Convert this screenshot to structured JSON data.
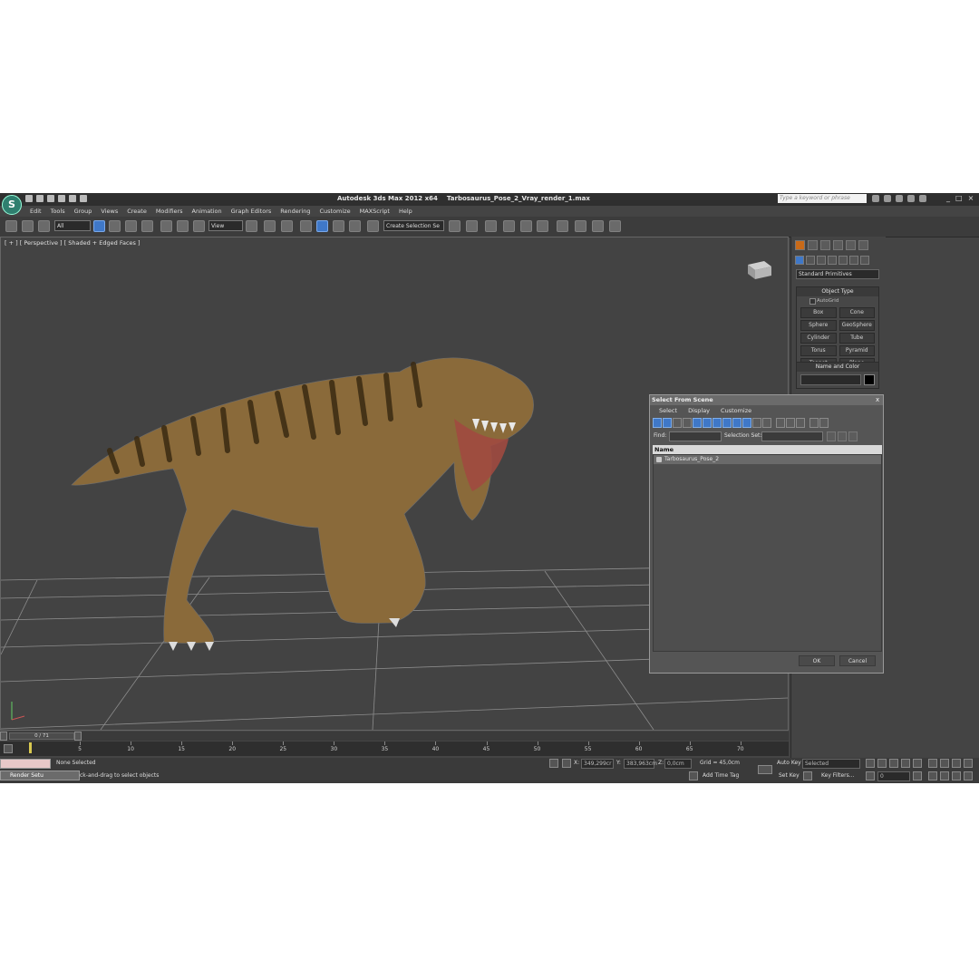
{
  "app": {
    "title": "Autodesk 3ds Max  2012 x64",
    "file": "Tarbosaurus_Pose_2_Vray_render_1.max",
    "search_placeholder": "Type a keyword or phrase"
  },
  "menu": [
    "Edit",
    "Tools",
    "Group",
    "Views",
    "Create",
    "Modifiers",
    "Animation",
    "Graph Editors",
    "Rendering",
    "Customize",
    "MAXScript",
    "Help"
  ],
  "toolbar": {
    "filter_value": "All",
    "coord_system": "View",
    "selection_set_placeholder": "Create Selection Se"
  },
  "viewport": {
    "label": "[ + ] [ Perspective ] [ Shaded + Edged Faces ]"
  },
  "command_panel": {
    "category": "Standard Primitives",
    "object_type_title": "Object Type",
    "autogrid_label": "AutoGrid",
    "object_buttons": [
      "Box",
      "Cone",
      "Sphere",
      "GeoSphere",
      "Cylinder",
      "Tube",
      "Torus",
      "Pyramid",
      "Teapot",
      "Plane"
    ],
    "name_color_title": "Name and Color"
  },
  "dialog": {
    "title": "Select From Scene",
    "close": "x",
    "menu": [
      "Select",
      "Display",
      "Customize"
    ],
    "find_label": "Find:",
    "selection_set_label": "Selection Set:",
    "column_name": "Name",
    "items": [
      "Tarbosaurus_Pose_2"
    ],
    "ok_label": "OK",
    "cancel_label": "Cancel"
  },
  "timeline": {
    "slider_label": "0 / 71",
    "ticks": [
      5,
      10,
      15,
      20,
      25,
      30,
      35,
      40,
      45,
      50,
      55,
      60,
      65,
      70
    ]
  },
  "status": {
    "selection": "None Selected",
    "prompt": "ck-and-drag to select objects",
    "x_label": "X:",
    "x_value": "349,299cr",
    "y_label": "Y:",
    "y_value": "383,963cm",
    "z_label": "Z:",
    "z_value": "0,0cm",
    "grid": "Grid = 45,0cm",
    "add_time_tag": "Add Time Tag",
    "auto_key": "Auto Key",
    "auto_key_value": "Selected",
    "set_key": "Set Key",
    "key_filters": "Key Filters...",
    "frame_value": "0",
    "taskbar_label": "Render Setu"
  },
  "colors": {
    "app_bg": "#444444",
    "viewport_bg": "#434343",
    "accent": "#3f78c8",
    "dino_skin": "#8a6a3a"
  }
}
